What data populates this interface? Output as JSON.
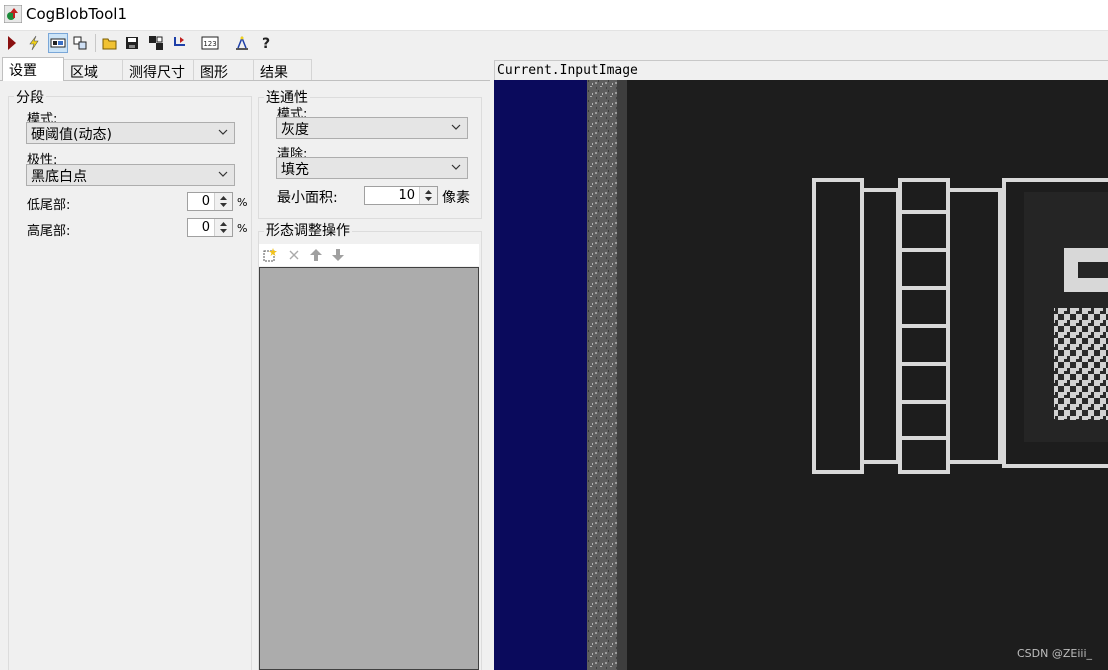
{
  "window": {
    "title": "CogBlobTool1"
  },
  "toolbar": {
    "buttons": [
      "run-icon",
      "electric-icon",
      "image-display-icon",
      "replace-icon",
      "open-icon",
      "save-icon",
      "reset-icon",
      "reset-stats-icon",
      "result-count-icon",
      "training-icon",
      "help-icon"
    ]
  },
  "tabs": [
    "设置",
    "区域",
    "测得尺寸",
    "图形",
    "结果"
  ],
  "segmentation": {
    "group_title": "分段",
    "mode_label": "模式:",
    "mode_value": "硬阈值(动态)",
    "polarity_label": "极性:",
    "polarity_value": "黑底白点",
    "low_tail_label": "低尾部:",
    "low_tail_value": "0",
    "high_tail_label": "高尾部:",
    "high_tail_value": "0",
    "percent": "%"
  },
  "connectivity": {
    "group_title": "连通性",
    "mode_label": "模式:",
    "mode_value": "灰度",
    "cleanup_label": "清除:",
    "cleanup_value": "填充",
    "min_area_label": "最小面积:",
    "min_area_value": "10",
    "unit": "像素"
  },
  "morphology": {
    "group_title": "形态调整操作",
    "toolbar_icons": [
      "add-icon",
      "delete-icon",
      "move-up-icon",
      "move-down-icon"
    ]
  },
  "viewer": {
    "title": "Current.InputImage"
  },
  "watermark": "CSDN @ZEiii_",
  "colors": {
    "viewer_blue": "#0a0a5c",
    "list_gray": "#acacac"
  }
}
